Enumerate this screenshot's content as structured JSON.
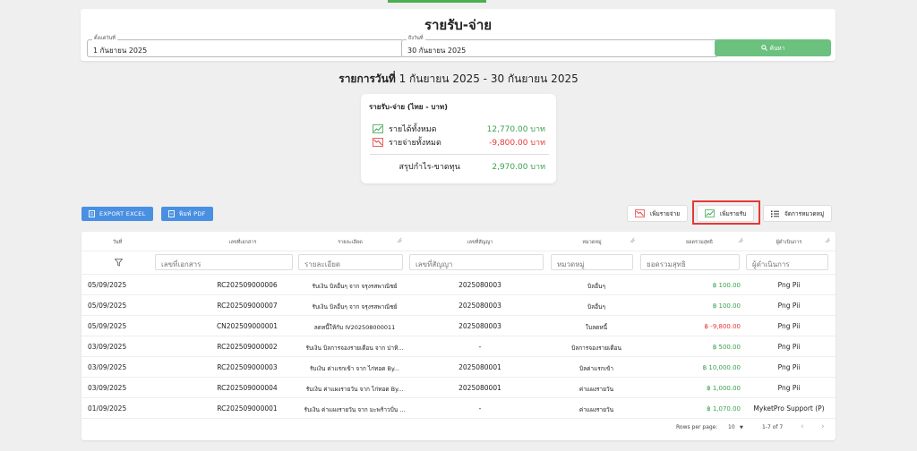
{
  "header": {
    "title": "รายรับ-จ่าย",
    "start_date_label": "ตั้งแต่วันที่",
    "start_date_value": "1 กันยายน 2025",
    "end_date_label": "ถึงวันที่",
    "end_date_value": "30 กันยายน 2025",
    "search_label": "ค้นหา"
  },
  "period": {
    "prefix": "รายการวันที่",
    "range": " 1 กันยายน 2025 - 30 กันยายน 2025"
  },
  "summary": {
    "title": "รายรับ-จ่าย (ไทย - บาท)",
    "income_label": "รายได้ทั้งหมด",
    "income_value": "12,770.00 บาท",
    "expense_label": "รายจ่ายทั้งหมด",
    "expense_value": "-9,800.00 บาท",
    "net_label": "สรุปกำไร-ขาดทุน",
    "net_value": "2,970.00 บาท"
  },
  "toolbar": {
    "export_excel": "EXPORT EXCEL",
    "print_pdf": "พิมพ์ PDF",
    "add_expense": "เพิ่มรายจ่าย",
    "add_income": "เพิ่มรายรับ",
    "manage_categories": "จัดการหมวดหมู่"
  },
  "table": {
    "headers": [
      "วันที่",
      "เลขที่เอกสาร",
      "รายละเอียด",
      "เลขที่สัญญา",
      "หมวดหมู่",
      "ยอดรวมสุทธิ",
      "ผู้ดำเนินการ"
    ],
    "filters": [
      "เลขที่เอกสาร",
      "รายละเอียด",
      "เลขที่สัญญา",
      "หมวดหมู่",
      "ยอดรวมสุทธิ",
      "ผู้ดำเนินการ"
    ],
    "rows": [
      {
        "date": "05/09/2025",
        "doc": "RC202509000006",
        "desc": "รับเงิน บิลอื่นๆ จาก จรุงรสพาณิชย์",
        "ref": "2025080003",
        "cat": "บิลอื่นๆ",
        "amount": "฿ 100.00",
        "user": "Png Pii"
      },
      {
        "date": "05/09/2025",
        "doc": "RC202509000007",
        "desc": "รับเงิน บิลอื่นๆ จาก จรุงรสพาณิชย์",
        "ref": "2025080003",
        "cat": "บิลอื่นๆ",
        "amount": "฿ 100.00",
        "user": "Png Pii"
      },
      {
        "date": "05/09/2025",
        "doc": "CN202509000001",
        "desc": "ลดหนี้ให้กับ IV202508000011",
        "ref": "2025080003",
        "cat": "ใบลดหนี้",
        "amount": "฿ -9,800.00",
        "user": "Png Pii"
      },
      {
        "date": "03/09/2025",
        "doc": "RC202509000002",
        "desc": "รับเงิน บิลการจองรายเดือน จาก ปาทิ...",
        "ref": "-",
        "cat": "บิลการจองรายเดือน",
        "amount": "฿ 500.00",
        "user": "Png Pii"
      },
      {
        "date": "03/09/2025",
        "doc": "RC202509000003",
        "desc": "รับเงิน ค่าแรกเข้า จาก ไก่ทอด By...",
        "ref": "2025080001",
        "cat": "บิลค่าแรกเข้า",
        "amount": "฿ 10,000.00",
        "user": "Png Pii"
      },
      {
        "date": "03/09/2025",
        "doc": "RC202509000004",
        "desc": "รับเงิน ค่าแผงรายวัน จาก ไก่ทอด By...",
        "ref": "2025080001",
        "cat": "ค่าแผงรายวัน",
        "amount": "฿ 1,000.00",
        "user": "Png Pii"
      },
      {
        "date": "01/09/2025",
        "doc": "RC202509000001",
        "desc": "รับเงิน ค่าแผงรายวัน จาก มะพร้าวปั่น ...",
        "ref": "-",
        "cat": "ค่าแผงรายวัน",
        "amount": "฿ 1,070.00",
        "user": "MyketPro Support (P)"
      }
    ]
  },
  "pagination": {
    "rows_per_page_label": "Rows per page:",
    "rows_per_page_value": "10",
    "range": "1-7 of 7"
  },
  "colors": {
    "accent_green": "#6cc17e",
    "income_green": "#3aa24f",
    "expense_red": "#e53935",
    "button_blue": "#4a90e2"
  }
}
